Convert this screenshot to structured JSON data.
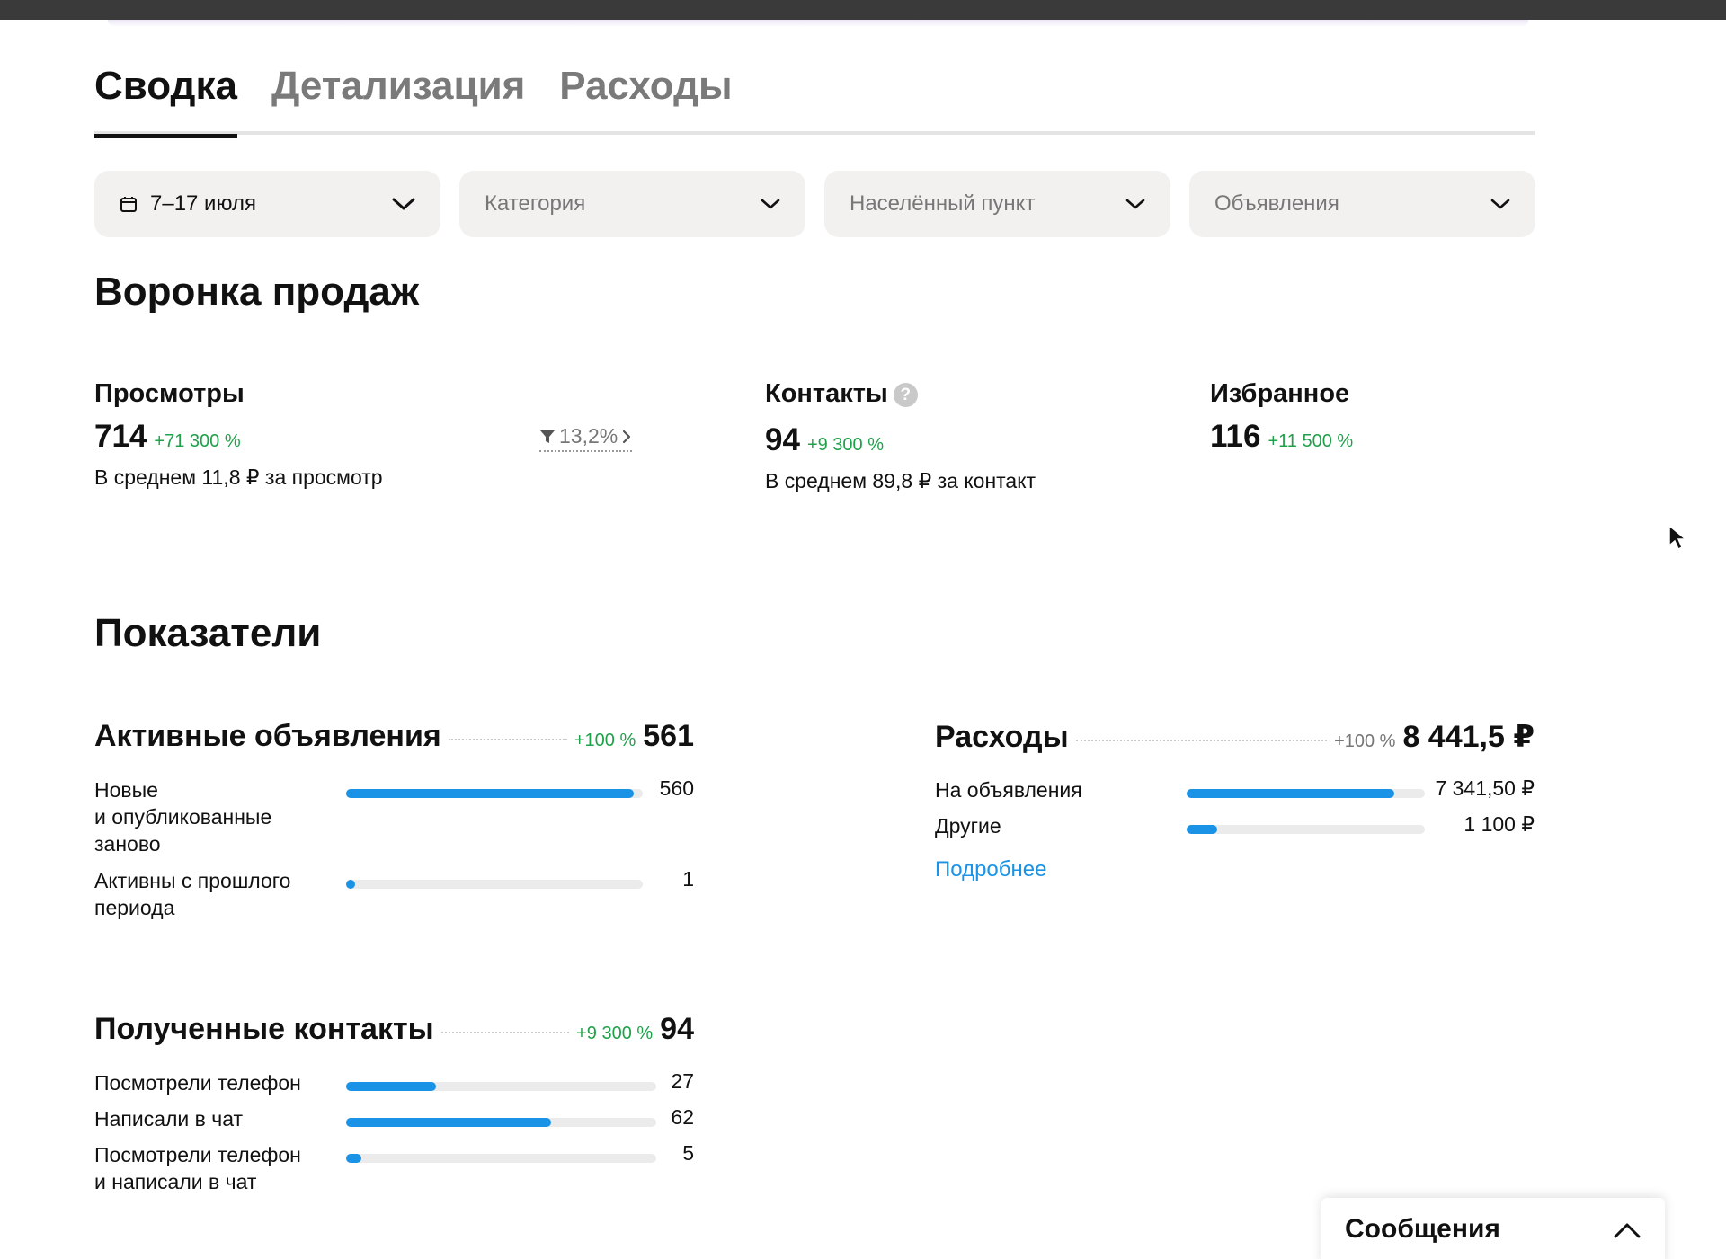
{
  "tabs": [
    {
      "label": "Сводка",
      "active": true
    },
    {
      "label": "Детализация",
      "active": false
    },
    {
      "label": "Расходы",
      "active": false
    }
  ],
  "filters": {
    "period": "7–17 июля",
    "category": "Категория",
    "location": "Населённый пункт",
    "ads": "Объявления"
  },
  "funnel": {
    "title": "Воронка продаж",
    "views": {
      "label": "Просмотры",
      "value": "714",
      "delta": "+71 300 %",
      "sub": "В среднем 11,8 ₽ за просмотр",
      "conversion": "13,2%"
    },
    "contacts": {
      "label": "Контакты",
      "help": "?",
      "value": "94",
      "delta": "+9 300 %",
      "sub": "В среднем 89,8 ₽ за контакт"
    },
    "favorites": {
      "label": "Избранное",
      "value": "116",
      "delta": "+11 500 %"
    }
  },
  "indicators": {
    "title": "Показатели",
    "active_ads": {
      "label": "Активные объявления",
      "delta": "+100 %",
      "value": "561",
      "rows": [
        {
          "label": "Новые\nи опубликованные\nзаново",
          "value": "560",
          "fraction": 0.97
        },
        {
          "label": "Активны с прошлого\nпериода",
          "value": "1",
          "fraction": 0.03
        }
      ]
    },
    "expenses": {
      "label": "Расходы",
      "delta": "+100 %",
      "value": "8 441,5 ₽",
      "rows": [
        {
          "label": "На объявления",
          "value": "7 341,50 ₽",
          "fraction": 0.87
        },
        {
          "label": "Другие",
          "value": "1 100 ₽",
          "fraction": 0.13
        }
      ],
      "more": "Подробнее"
    },
    "contacts_received": {
      "label": "Полученные контакты",
      "delta": "+9 300 %",
      "value": "94",
      "rows": [
        {
          "label": "Посмотрели телефон",
          "value": "27",
          "fraction": 0.29
        },
        {
          "label": "Написали в чат",
          "value": "62",
          "fraction": 0.66
        },
        {
          "label": "Посмотрели телефон\nи написали в чат",
          "value": "5",
          "fraction": 0.05
        }
      ]
    }
  },
  "messages": {
    "label": "Сообщения"
  },
  "colors": {
    "accent": "#1a93e6",
    "positive": "#1fa14a",
    "muted": "#777777"
  }
}
